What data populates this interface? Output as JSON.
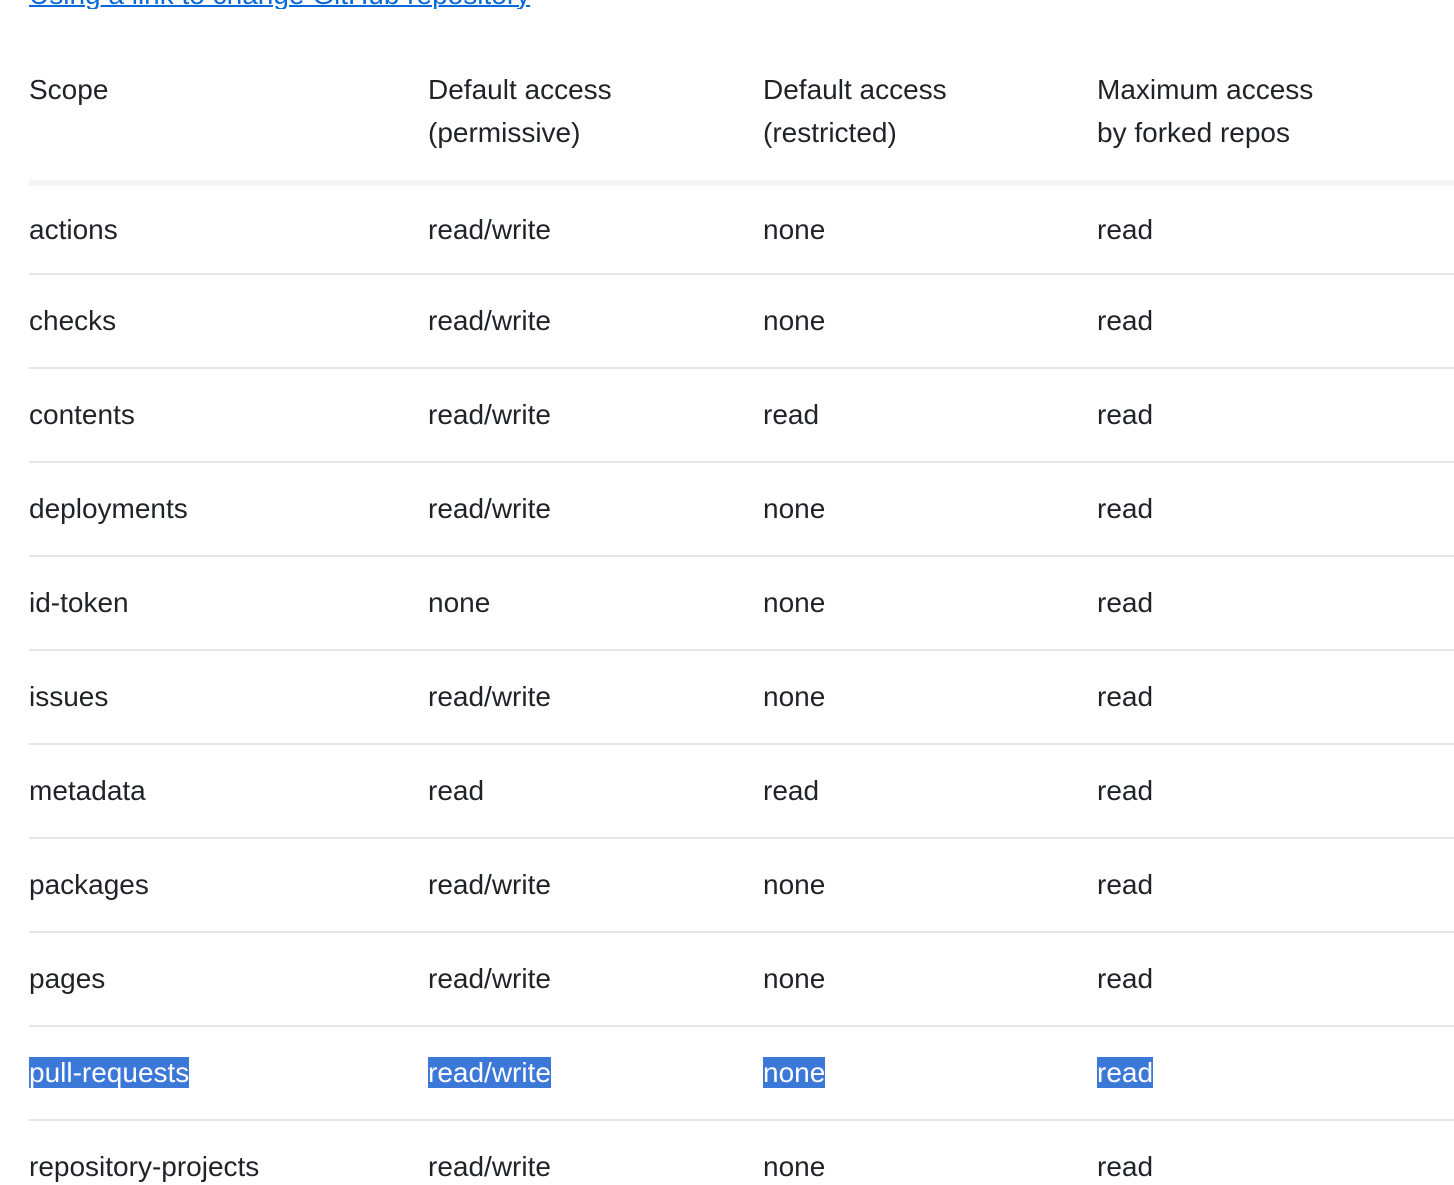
{
  "top_link": {
    "text": "Using a link to change GitHub repository"
  },
  "table": {
    "headers": [
      [
        "Scope",
        ""
      ],
      [
        "Default access",
        "(permissive)"
      ],
      [
        "Default access",
        "(restricted)"
      ],
      [
        "Maximum access",
        "by forked repos"
      ]
    ],
    "rows": [
      {
        "scope": "actions",
        "permissive": "read/write",
        "restricted": "none",
        "forked": "read"
      },
      {
        "scope": "checks",
        "permissive": "read/write",
        "restricted": "none",
        "forked": "read"
      },
      {
        "scope": "contents",
        "permissive": "read/write",
        "restricted": "read",
        "forked": "read"
      },
      {
        "scope": "deployments",
        "permissive": "read/write",
        "restricted": "none",
        "forked": "read"
      },
      {
        "scope": "id-token",
        "permissive": "none",
        "restricted": "none",
        "forked": "read"
      },
      {
        "scope": "issues",
        "permissive": "read/write",
        "restricted": "none",
        "forked": "read"
      },
      {
        "scope": "metadata",
        "permissive": "read",
        "restricted": "read",
        "forked": "read"
      },
      {
        "scope": "packages",
        "permissive": "read/write",
        "restricted": "none",
        "forked": "read"
      },
      {
        "scope": "pages",
        "permissive": "read/write",
        "restricted": "none",
        "forked": "read"
      },
      {
        "scope": "pull-requests",
        "permissive": "read/write",
        "restricted": "none",
        "forked": "read",
        "selected": true
      },
      {
        "scope": "repository-projects",
        "permissive": "read/write",
        "restricted": "none",
        "forked": "read"
      }
    ]
  },
  "colors": {
    "text": "#1f2328",
    "link": "#0969da",
    "selection": "#3b78d8",
    "row_border": "#e6e6e6",
    "header_border": "#f4f4f5"
  }
}
